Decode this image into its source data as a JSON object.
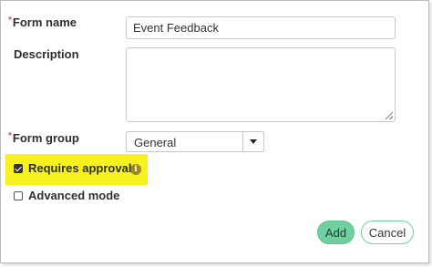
{
  "form": {
    "name_label": "Form name",
    "name_value": "Event Feedback",
    "description_label": "Description",
    "description_value": "",
    "group_label": "Form group",
    "group_value": "General",
    "requires_approval_label": "Requires approval",
    "requires_approval_checked": true,
    "advanced_mode_label": "Advanced mode",
    "advanced_mode_checked": false,
    "required_marker": "*"
  },
  "actions": {
    "add_label": "Add",
    "cancel_label": "Cancel"
  },
  "colors": {
    "highlight": "#f7f21f",
    "accent": "#6fcf9f",
    "required": "#d9534f"
  },
  "icons": {
    "info": "info-icon",
    "dropdown": "chevron-down-icon"
  }
}
